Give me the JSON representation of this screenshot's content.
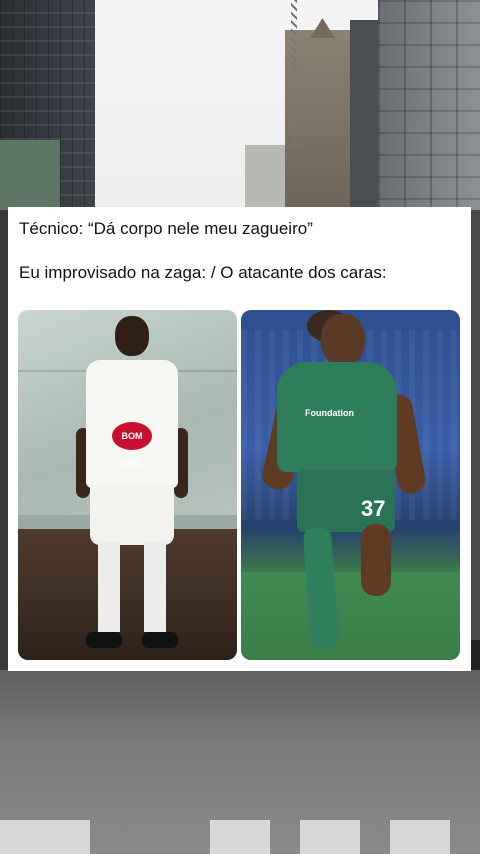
{
  "meme": {
    "line1": "Técnico: “Dá corpo nele meu zagueiro”",
    "line2": "Eu improvisado na zaga: / O atacante dos caras:"
  },
  "left_photo": {
    "badge_text": "BOM BRIL"
  },
  "right_photo": {
    "shirt_number": "37",
    "sponsor_text": "Foundation"
  },
  "colors": {
    "card_bg": "#ffffff",
    "text": "#111111",
    "kit_white": "#f7f7f4",
    "kit_green": "#2e7d5b"
  }
}
